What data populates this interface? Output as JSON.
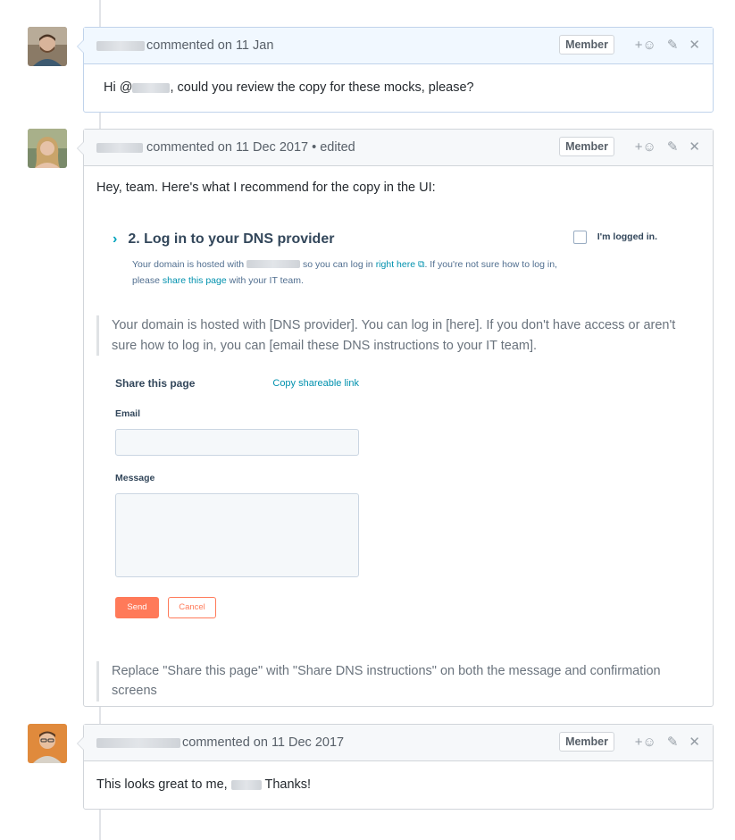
{
  "comments": [
    {
      "action": "commented on 11 Jan",
      "badge": "Member",
      "body_prefix": "Hi @",
      "body_suffix": ", could you review the copy for these mocks, please?"
    },
    {
      "action": "commented on 11 Dec 2017 • edited",
      "badge": "Member",
      "intro": "Hey, team. Here's what I recommend for the copy in the UI:",
      "mock": {
        "title": "2. Log in to your DNS provider",
        "sub_1": "Your domain is hosted with",
        "sub_2": "so you can log in",
        "link_right_here": "right here",
        "sub_3": ". If you're not sure how to log in, please",
        "link_share": "share this page",
        "sub_4": "with your IT team.",
        "checkbox_label": "I'm logged in."
      },
      "quote_1": "Your domain is hosted with [DNS provider]. You can log in [here]. If you don't have access or aren't sure how to log in, you can [email these DNS instructions to your IT team].",
      "share": {
        "title": "Share this page",
        "copy_link": "Copy shareable link",
        "email_label": "Email",
        "message_label": "Message",
        "send": "Send",
        "cancel": "Cancel"
      },
      "quote_2": "Replace \"Share this page\" with \"Share DNS instructions\" on both the message and confirmation screens"
    },
    {
      "action": "commented on 11 Dec 2017",
      "badge": "Member",
      "body_prefix": "This looks great to me,",
      "body_suffix": "Thanks!"
    }
  ],
  "icons": {
    "reaction": "add-reaction-icon",
    "edit": "pencil-icon",
    "delete": "close-icon"
  },
  "colors": {
    "hubspot_orange": "#ff7a59",
    "hubspot_teal": "#00a4bd",
    "highlight_header": "#f1f8ff"
  }
}
